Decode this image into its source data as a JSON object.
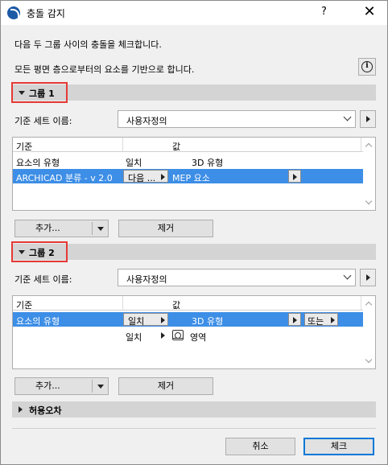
{
  "window": {
    "title": "충돌 감지",
    "help_label": "?",
    "close_label": "✕"
  },
  "intro": {
    "line1": "다음 두 그룹 사이의 충돌을 체크합니다.",
    "line2": "모든 평면 층으로부터의 요소를 기반으로 합니다.",
    "info_icon": "info-icon",
    "info_glyph": "i"
  },
  "group1": {
    "title": "그룹 1",
    "criteria_label": "기준 세트 이름:",
    "criteria_value": "사용자정의",
    "table": {
      "headers": [
        "기준",
        "값"
      ],
      "sub_headers": [
        "요소의 유형",
        "일치",
        "3D 유형"
      ],
      "rows": [
        {
          "criterion": "ARCHICAD 분류 - v 2.0",
          "operator": "다음 ...",
          "value": "MEP 요소",
          "selected": true
        }
      ]
    },
    "add_label": "추가...",
    "remove_label": "제거"
  },
  "group2": {
    "title": "그룹 2",
    "criteria_label": "기준 세트 이름:",
    "criteria_value": "사용자정의",
    "table": {
      "headers": [
        "기준",
        "값"
      ],
      "rows": [
        {
          "criterion": "요소의 유형",
          "operator": "일치",
          "value": "3D 유형",
          "or_label": "또는",
          "selected": true
        },
        {
          "criterion": "",
          "operator": "일치",
          "value": "영역",
          "value_icon": "zone-icon",
          "selected": false
        }
      ]
    },
    "add_label": "추가...",
    "remove_label": "제거"
  },
  "tolerance": {
    "title": "허용오차"
  },
  "footer": {
    "cancel_label": "취소",
    "ok_label": "체크"
  },
  "colors": {
    "selection": "#3d8ee6",
    "highlight_box": "#e53935",
    "default_button": "#0078d7"
  }
}
